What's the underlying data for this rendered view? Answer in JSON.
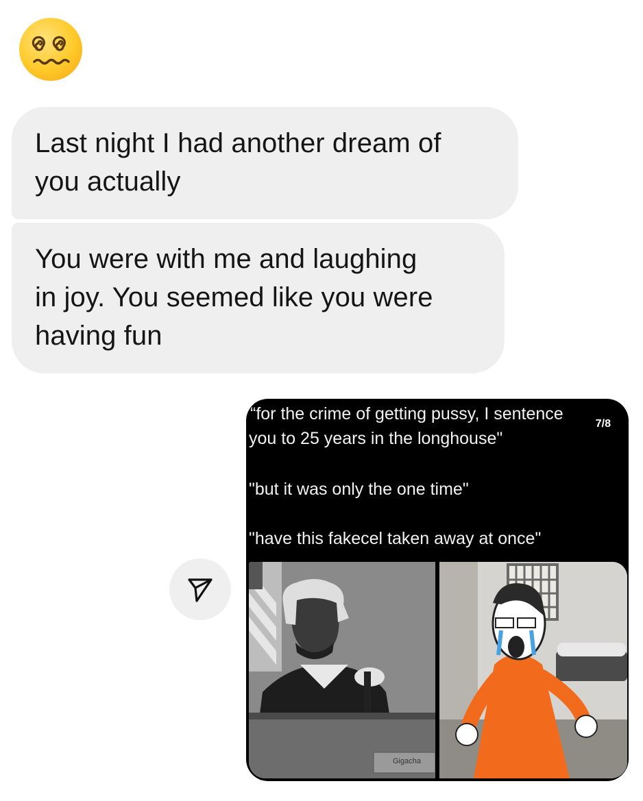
{
  "reaction": {
    "emoji": "face-with-spiral-eyes-icon"
  },
  "messages": [
    {
      "text_lines": [
        "Last night I had another dream of",
        "you actually"
      ]
    },
    {
      "text_lines": [
        "You were with me and laughing",
        "in joy. You seemed like you were",
        "having fun"
      ]
    }
  ],
  "shared_post": {
    "counter": "7/8",
    "caption_lines": [
      "“for the crime of getting pussy, I sentence",
      "you to 25 years in the longhouse\"",
      "\"but it was only the one time\"",
      "\"have this fakecel taken away at once\""
    ],
    "nameplate": "Gigacha"
  },
  "share_button": {
    "icon": "send-arrow-icon"
  },
  "colors": {
    "bubble": "#efefef",
    "background": "#ffffff",
    "media_bg": "#000000",
    "jumpsuit": "#f26b1d"
  }
}
